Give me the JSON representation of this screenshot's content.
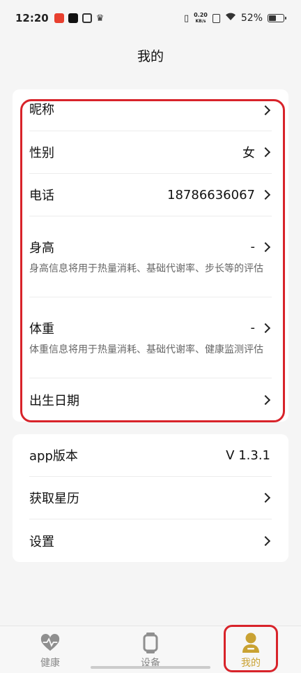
{
  "status_bar": {
    "time": "12:20",
    "net_speed_value": "0.20",
    "net_speed_unit": "KB/s",
    "battery_percent": "52%",
    "battery_level": 0.52
  },
  "header": {
    "title": "我的"
  },
  "profile_card": {
    "nickname_label": "昵称",
    "gender_label": "性别",
    "gender_value": "女",
    "phone_label": "电话",
    "phone_value": "18786636067",
    "height_label": "身高",
    "height_value": "-",
    "height_desc": "身高信息将用于热量消耗、基础代谢率、步长等的评估",
    "weight_label": "体重",
    "weight_value": "-",
    "weight_desc": "体重信息将用于热量消耗、基础代谢率、健康监测评估",
    "birthday_label": "出生日期"
  },
  "app_card": {
    "version_label": "app版本",
    "version_value": "V 1.3.1",
    "calendar_label": "获取星历",
    "settings_label": "设置"
  },
  "bottom_nav": {
    "health_label": "健康",
    "device_label": "设备",
    "mine_label": "我的",
    "active_color": "#c9a233",
    "inactive_color": "#888888"
  },
  "annotation_color": "#d8232a"
}
